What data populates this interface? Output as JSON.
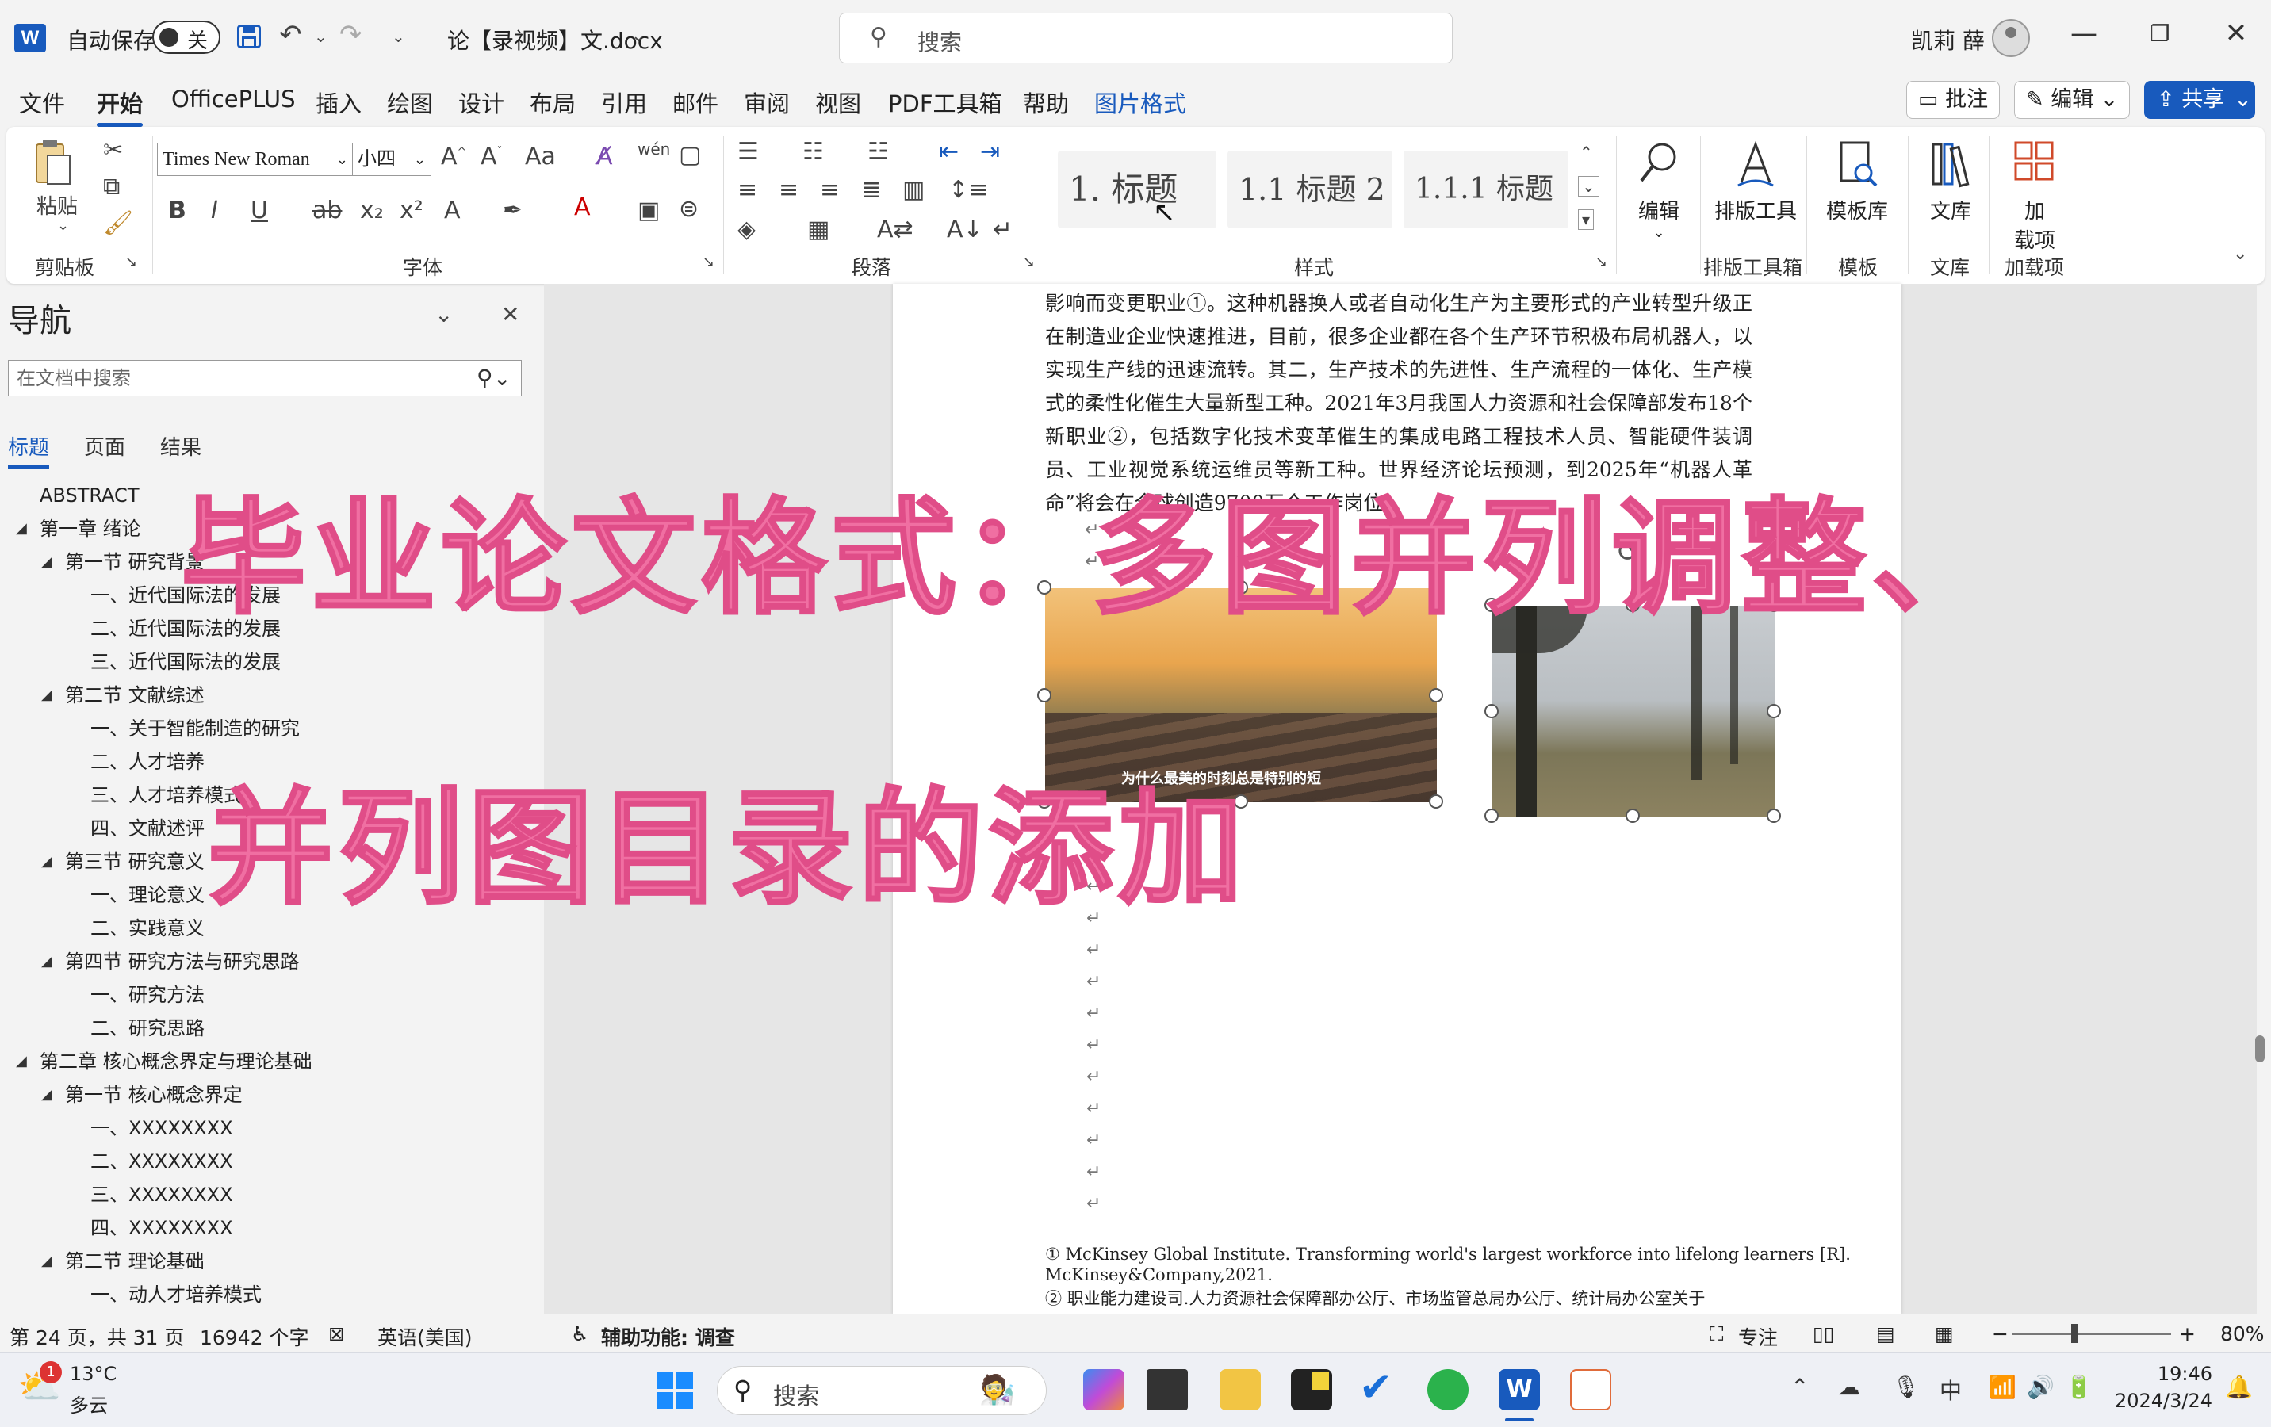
{
  "titlebar": {
    "autosave_label": "自动保存",
    "autosave_state": "关",
    "doc_title": "论【录视频】文.docx",
    "search_placeholder": "搜索",
    "user_name": "凯莉 薛"
  },
  "menu": {
    "tabs": [
      "文件",
      "开始",
      "OfficePLUS",
      "插入",
      "绘图",
      "设计",
      "布局",
      "引用",
      "邮件",
      "审阅",
      "视图",
      "PDF工具箱",
      "帮助",
      "图片格式"
    ],
    "comment_btn": "批注",
    "edit_btn": "编辑",
    "share_btn": "共享"
  },
  "ribbon": {
    "paste": "粘贴",
    "font_name": "Times New Roman",
    "font_size": "小四",
    "style1": "1. 标题",
    "style2": "1.1 标题 2",
    "style3": "1.1.1 标题",
    "edit": "编辑",
    "layout_tool": "排版工具",
    "template_lib": "模板库",
    "wenku": "文库",
    "addins_1": "加",
    "addins_2": "载项",
    "groups": {
      "clipboard": "剪贴板",
      "font": "字体",
      "paragraph": "段落",
      "styles": "样式",
      "layout": "排版工具箱",
      "template": "模板",
      "wenku": "文库",
      "addins": "加载项"
    }
  },
  "nav": {
    "title": "导航",
    "search_placeholder": "在文档中搜索",
    "tabs": [
      "标题",
      "页面",
      "结果"
    ],
    "tree": [
      {
        "level": 0,
        "text": "ABSTRACT",
        "tri": false
      },
      {
        "level": 0,
        "text": "第一章  绪论",
        "tri": true
      },
      {
        "level": 1,
        "text": "第一节  研究背景",
        "tri": true
      },
      {
        "level": 2,
        "text": "一、近代国际法的发展",
        "tri": false
      },
      {
        "level": 2,
        "text": "二、近代国际法的发展",
        "tri": false
      },
      {
        "level": 2,
        "text": "三、近代国际法的发展",
        "tri": false
      },
      {
        "level": 1,
        "text": "第二节  文献综述",
        "tri": true
      },
      {
        "level": 2,
        "text": "一、关于智能制造的研究",
        "tri": false
      },
      {
        "level": 2,
        "text": "二、人才培养",
        "tri": false
      },
      {
        "level": 2,
        "text": "三、人才培养模式",
        "tri": false
      },
      {
        "level": 2,
        "text": "四、文献述评",
        "tri": false
      },
      {
        "level": 1,
        "text": "第三节  研究意义",
        "tri": true
      },
      {
        "level": 2,
        "text": "一、理论意义",
        "tri": false
      },
      {
        "level": 2,
        "text": "二、实践意义",
        "tri": false
      },
      {
        "level": 1,
        "text": "第四节  研究方法与研究思路",
        "tri": true
      },
      {
        "level": 2,
        "text": "一、研究方法",
        "tri": false
      },
      {
        "level": 2,
        "text": "二、研究思路",
        "tri": false
      },
      {
        "level": 0,
        "text": "第二章  核心概念界定与理论基础",
        "tri": true
      },
      {
        "level": 1,
        "text": "第一节  核心概念界定",
        "tri": true
      },
      {
        "level": 2,
        "text": "一、XXXXXXXX",
        "tri": false
      },
      {
        "level": 2,
        "text": "二、XXXXXXXX",
        "tri": false
      },
      {
        "level": 2,
        "text": "三、XXXXXXXX",
        "tri": false
      },
      {
        "level": 2,
        "text": "四、XXXXXXXX",
        "tri": false
      },
      {
        "level": 1,
        "text": "第二节  理论基础",
        "tri": true
      },
      {
        "level": 2,
        "text": "一、动人才培养模式",
        "tri": false
      }
    ]
  },
  "document": {
    "paragraph": "影响而变更职业①。这种机器换人或者自动化生产为主要形式的产业转型升级正在制造业企业快速推进，目前，很多企业都在各个生产环节积极布局机器人，以实现生产线的迅速流转。其二，生产技术的先进性、生产流程的一体化、生产模式的柔性化催生大量新型工种。2021年3月我国人力资源和社会保障部发布18个新职业②，包括数字化技术变革催生的集成电路工程技术人员、智能硬件装调员、工业视觉系统运维员等新工种。世界经济论坛预测，到2025年“机器人革命”将会在全球创造9700万个工作岗位",
    "image1_caption": "为什么最美的时刻总是特别的短",
    "footnote1_line1": "① McKinsey Global Institute. Transforming world's largest workforce into lifelong learners [R].",
    "footnote1_line2": "McKinsey&Company,2021.",
    "footnote2": "② 职业能力建设司.人力资源社会保障部办公厅、市场监管总局办公厅、统计局办公室关于"
  },
  "overlay": {
    "line1": "毕业论文格式：多图并列调整、",
    "line2": "并列图目录的添加"
  },
  "status": {
    "page": "第 24 页，共 31 页",
    "words": "16942 个字",
    "lang": "英语(美国)",
    "accessibility": "辅助功能: 调查",
    "focus": "专注",
    "zoom": "80%"
  },
  "taskbar": {
    "temp": "13°C",
    "weather": "多云",
    "badge": "1",
    "search": "搜索",
    "ime": "中",
    "time": "19:46",
    "date": "2024/3/24"
  },
  "colors": {
    "accent": "#185abd",
    "overlay_pink": "#f06fa2"
  }
}
